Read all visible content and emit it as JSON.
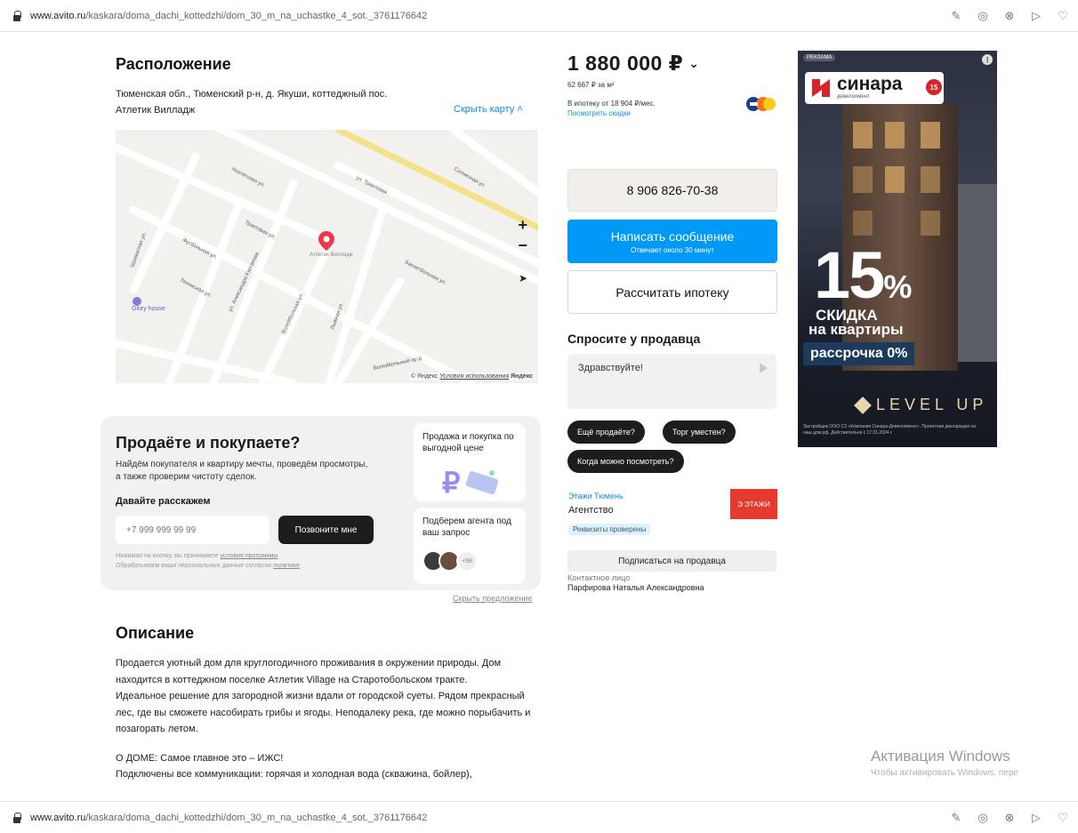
{
  "browser": {
    "url_host": "www.avito.ru",
    "url_path": "/kaskara/doma_dachi_kottedzhi/dom_30_m_na_uchastke_4_sot._3761176642"
  },
  "location": {
    "title": "Расположение",
    "address_line1": "Тюменская обл., Тюменский р-н, д. Якуши, коттеджный пос.",
    "address_line2": "Атлетик Вилладж",
    "hide_map": "Скрыть карту",
    "map": {
      "zoom_in": "+",
      "zoom_out": "−",
      "copyright": "© Яндекс",
      "terms": "Условия использования",
      "yandex": "Яндекс",
      "poi_label": "Glory house",
      "pin_label": "Атлетик Вилладж",
      "streets": [
        "Хохлатская ул.",
        "ул. Трактовая",
        "Солнечная ул.",
        "Трактовая ул.",
        "Футбольная ул.",
        "Шахматная ул.",
        "Теннисная ул.",
        "ул. Александра Курганова",
        "Волейбольная ул.",
        "Баскетбольная ул.",
        "Лыжная ул.",
        "Волейбольный пр-д"
      ]
    }
  },
  "sell_banner": {
    "title": "Продаёте и покупаете?",
    "subtitle": "Найдём покупателя и квартиру мечты, проведём просмотры, а также проверим чистоту сделок.",
    "ask": "Давайте расскажем",
    "phone_placeholder": "+7 999 999 99 99",
    "call_button": "Позвоните мне",
    "legal_line1_prefix": "Нажимая на кнопку, вы принимаете ",
    "legal_line1_link": "условия программы",
    "legal_line2_prefix": "Обрабатываем ваши персональные данные согласно ",
    "legal_line2_link": "политике",
    "card1": "Продажа и покупка по выгодной цене",
    "card2": "Подберем агента под ваш запрос",
    "card2_more": "+98",
    "hide_offer": "Скрыть предложение"
  },
  "description": {
    "title": "Описание",
    "p1": "Продается уютный дом для круглогодичного проживания в окружении природы. Дом находится в коттеджном поселке Атлетик Village на Старотобольском тракте.",
    "p2": "Идеальное решение для загородной жизни вдали от городской суеты. Рядом прекрасный лес, где вы сможете насобирать грибы и ягоды. Неподалеку река, где можно порыбачить и позагорать летом.",
    "p3": "О ДОМЕ: Самое главное это – ИЖС!",
    "p4": "Подключены все коммуникации: горячая и холодная вода (скважина, бойлер),"
  },
  "listing": {
    "price": "1 880 000 ₽",
    "price_per_m2": "62 667 ₽ за м²",
    "mortgage": "В ипотеку от 18 904 ₽/мес.",
    "discounts_link": "Посмотреть скидки",
    "phone_button": "8 906 826-70-38",
    "message_button": "Написать сообщение",
    "message_sub": "Отвечает около 30 минут",
    "mortgage_button": "Рассчитать ипотеку",
    "ask_title": "Спросите у продавца",
    "ask_text": "Здравствуйте!",
    "chips": [
      "Ещё продаёте?",
      "Торг уместен?",
      "Когда можно посмотреть?"
    ],
    "seller_name": "Этажи Тюмень",
    "seller_type": "Агентство",
    "seller_badge": "Реквизиты проверены",
    "seller_logo": "Э ЭТАЖИ",
    "subscribe_button": "Подписаться на продавца",
    "contact_label": "Контактное лицо",
    "contact_name": "Парфирова Наталья Александровна"
  },
  "ad": {
    "tag": "РЕКЛАМА",
    "brand": "синара",
    "brand_sub": "девелопмент",
    "badge": "15",
    "percent": "15",
    "percent_sign": "%",
    "discount_line1": "СКИДКА",
    "discount_line2": "на квартиры",
    "installment": "рассрочка 0%",
    "level": "LEVEL UP",
    "legal": "Застройщик ООО СЗ «Компания Синара-Девелопмент». Проектная декларация на наш.дом.рф. Действительна с 17.01.2024 г."
  },
  "windows": {
    "line1": "Активация Windows",
    "line2": "Чтобы активировать Windows, пере"
  }
}
